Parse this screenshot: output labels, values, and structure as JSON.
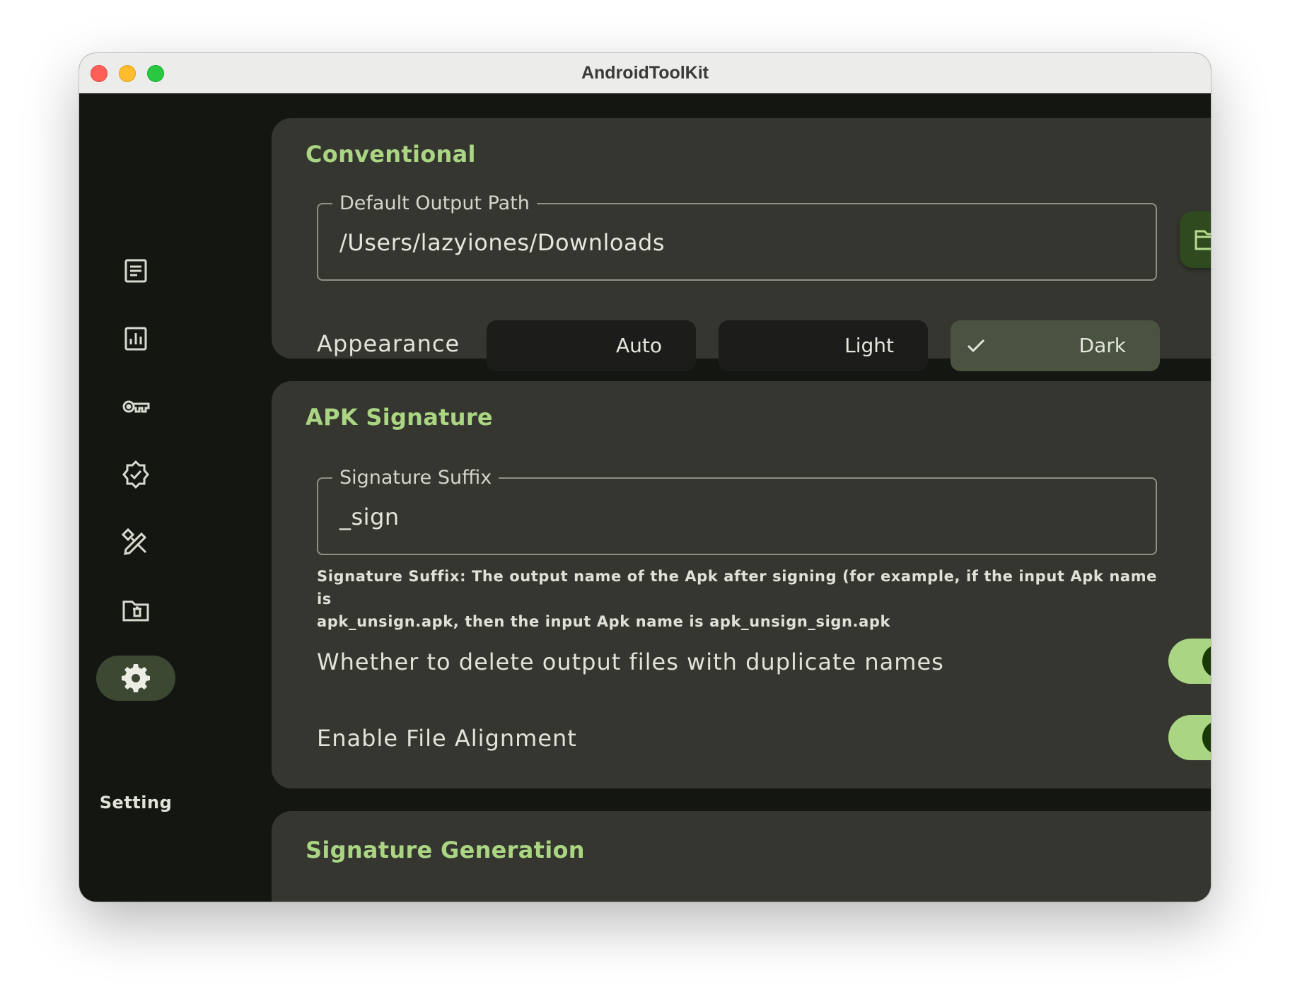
{
  "window": {
    "title": "AndroidToolKit"
  },
  "sidebar": {
    "items": [
      {
        "icon": "document-list-icon"
      },
      {
        "icon": "bar-chart-icon"
      },
      {
        "icon": "key-icon"
      },
      {
        "icon": "verified-badge-icon"
      },
      {
        "icon": "design-tools-icon"
      },
      {
        "icon": "folder-delete-icon"
      },
      {
        "icon": "gear-icon",
        "label": "Setting",
        "active": true
      }
    ]
  },
  "conventional": {
    "title": "Conventional",
    "output_path": {
      "label": "Default Output Path",
      "value": "/Users/lazyiones/Downloads"
    },
    "folder_button_icon": "folder-icon",
    "appearance": {
      "label": "Appearance",
      "options": [
        "Auto",
        "Light",
        "Dark"
      ],
      "selected": "Dark"
    }
  },
  "apk_signature": {
    "title": "APK Signature",
    "suffix": {
      "label": "Signature Suffix",
      "value": "_sign"
    },
    "help_line1": "Signature Suffix: The output name of the Apk after signing (for example, if the input Apk name is",
    "help_line2": "apk_unsign.apk, then the input Apk name is apk_unsign_sign.apk",
    "delete_duplicates": {
      "label": "Whether to delete output files with duplicate names",
      "enabled": true
    },
    "file_alignment": {
      "label": "Enable File Alignment",
      "enabled": true
    }
  },
  "signature_generation": {
    "title": "Signature Generation"
  },
  "colors": {
    "accent": "#aad582",
    "card_bg": "#353630",
    "window_bg": "#141612",
    "selected_segment": "#4a5340",
    "toggle_knob": "#1a3708"
  }
}
